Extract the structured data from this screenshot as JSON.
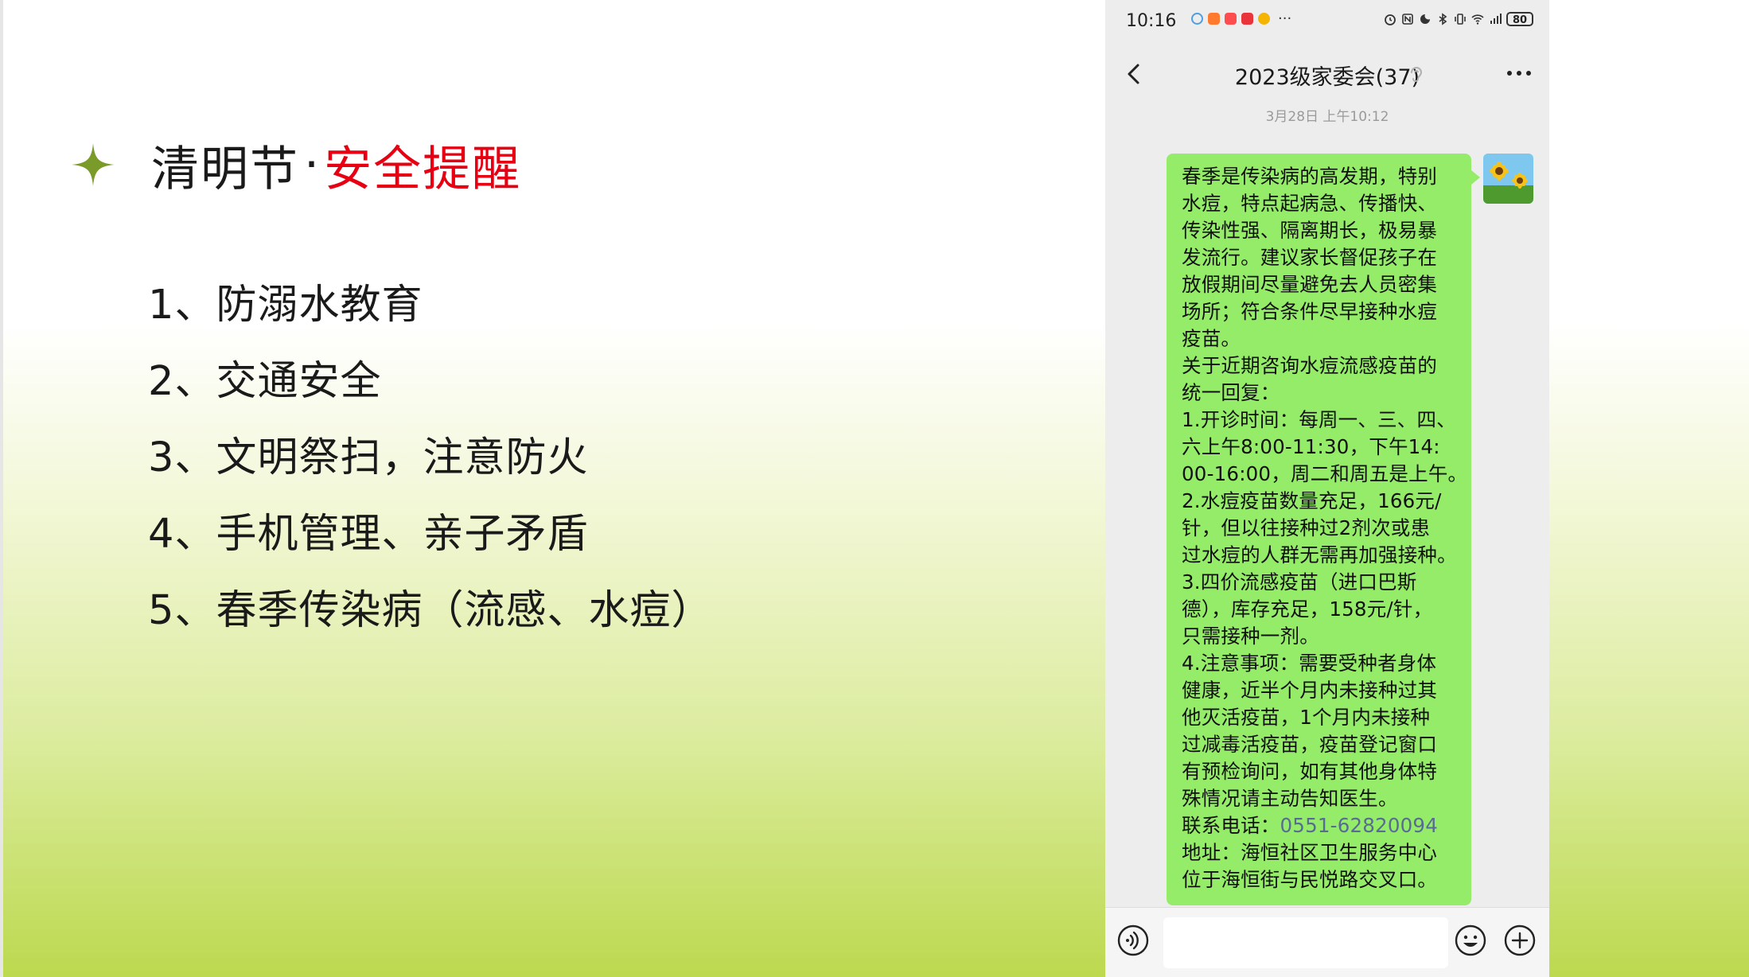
{
  "slide": {
    "title_main": "清明节",
    "title_sep": "·",
    "title_accent": "安全提醒",
    "accent_color": "#e60012",
    "star_color": "#7a9a2a",
    "items": [
      "1、防溺水教育",
      "2、交通安全",
      "3、文明祭扫，注意防火",
      "4、手机管理、亲子矛盾",
      "5、春季传染病（流感、水痘）"
    ]
  },
  "phone": {
    "status": {
      "time": "10:16",
      "more": "···",
      "battery": "80"
    },
    "nav": {
      "title": "2023级家委会(37)",
      "back_icon": "chevron-left-icon",
      "mute_icon": "ear-icon",
      "more_icon": "ellipsis-icon"
    },
    "timestamp": "3月28日 上午10:12",
    "message": {
      "bubble_color": "#95ec69",
      "lines": [
        "春季是传染病的高发期，特别",
        "水痘，特点起病急、传播快、",
        "传染性强、隔离期长，极易暴",
        "发流行。建议家长督促孩子在",
        "放假期间尽量避免去人员密集",
        "场所；符合条件尽早接种水痘",
        "疫苗。",
        "关于近期咨询水痘流感疫苗的",
        "统一回复：",
        "1.开诊时间：每周一、三、四、",
        "六上午8:00-11:30，下午14:",
        "00-16:00，周二和周五是上午。",
        "2.水痘疫苗数量充足，166元/",
        "针，但以往接种过2剂次或患",
        "过水痘的人群无需再加强接种。",
        "3.四价流感疫苗（进口巴斯",
        "德），库存充足，158元/针，",
        "只需接种一剂。",
        "4.注意事项：需要受种者身体",
        "健康，近半个月内未接种过其",
        "他灭活疫苗，1个月内未接种",
        "过减毒活疫苗，疫苗登记窗口",
        "有预检询问，如有其他身体特",
        "殊情况请主动告知医生。"
      ],
      "contact_label": "联系电话：",
      "contact_phone": "0551-62820094",
      "address_lines": [
        "地址：海恒社区卫生服务中心",
        "位于海恒街与民悦路交叉口。"
      ]
    },
    "input_bar": {
      "voice_icon": "voice-icon",
      "emoji_icon": "emoji-icon",
      "plus_icon": "plus-circle-icon",
      "input_value": ""
    }
  }
}
